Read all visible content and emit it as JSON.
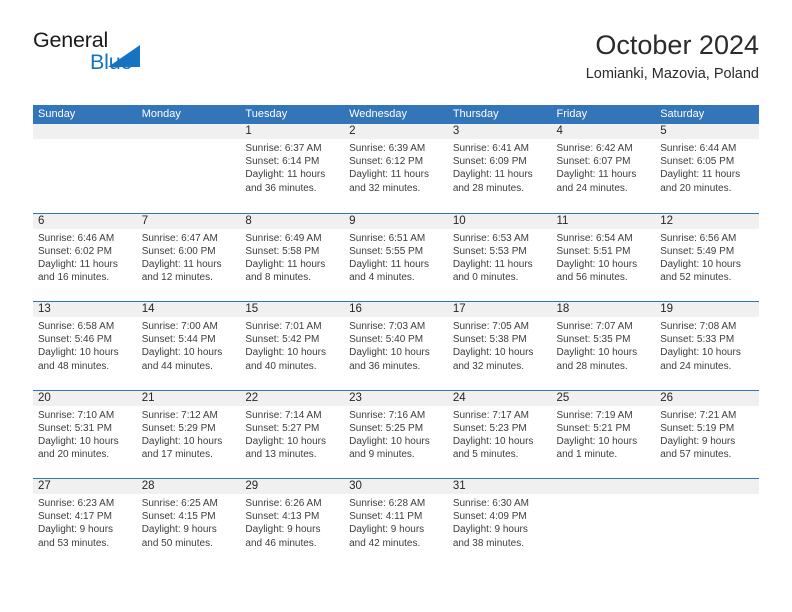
{
  "brand": {
    "name_top": "General",
    "name_bottom": "Blue",
    "triangle_color": "#1673c1",
    "top_color": "#1a1a1a",
    "bottom_color": "#1673c1"
  },
  "header": {
    "title": "October 2024",
    "location": "Lomianki, Mazovia, Poland"
  },
  "theme": {
    "header_blue": "#3275b8",
    "daynum_band": "#f0f0f0",
    "text": "#3d3d3d"
  },
  "weekday_headers": [
    "Sunday",
    "Monday",
    "Tuesday",
    "Wednesday",
    "Thursday",
    "Friday",
    "Saturday"
  ],
  "weeks": [
    [
      {
        "day": "",
        "sunrise": "",
        "sunset": "",
        "daylight_1": "",
        "daylight_2": "",
        "empty": true
      },
      {
        "day": "",
        "sunrise": "",
        "sunset": "",
        "daylight_1": "",
        "daylight_2": "",
        "empty": true
      },
      {
        "day": "1",
        "sunrise": "Sunrise: 6:37 AM",
        "sunset": "Sunset: 6:14 PM",
        "daylight_1": "Daylight: 11 hours",
        "daylight_2": "and 36 minutes."
      },
      {
        "day": "2",
        "sunrise": "Sunrise: 6:39 AM",
        "sunset": "Sunset: 6:12 PM",
        "daylight_1": "Daylight: 11 hours",
        "daylight_2": "and 32 minutes."
      },
      {
        "day": "3",
        "sunrise": "Sunrise: 6:41 AM",
        "sunset": "Sunset: 6:09 PM",
        "daylight_1": "Daylight: 11 hours",
        "daylight_2": "and 28 minutes."
      },
      {
        "day": "4",
        "sunrise": "Sunrise: 6:42 AM",
        "sunset": "Sunset: 6:07 PM",
        "daylight_1": "Daylight: 11 hours",
        "daylight_2": "and 24 minutes."
      },
      {
        "day": "5",
        "sunrise": "Sunrise: 6:44 AM",
        "sunset": "Sunset: 6:05 PM",
        "daylight_1": "Daylight: 11 hours",
        "daylight_2": "and 20 minutes."
      }
    ],
    [
      {
        "day": "6",
        "sunrise": "Sunrise: 6:46 AM",
        "sunset": "Sunset: 6:02 PM",
        "daylight_1": "Daylight: 11 hours",
        "daylight_2": "and 16 minutes."
      },
      {
        "day": "7",
        "sunrise": "Sunrise: 6:47 AM",
        "sunset": "Sunset: 6:00 PM",
        "daylight_1": "Daylight: 11 hours",
        "daylight_2": "and 12 minutes."
      },
      {
        "day": "8",
        "sunrise": "Sunrise: 6:49 AM",
        "sunset": "Sunset: 5:58 PM",
        "daylight_1": "Daylight: 11 hours",
        "daylight_2": "and 8 minutes."
      },
      {
        "day": "9",
        "sunrise": "Sunrise: 6:51 AM",
        "sunset": "Sunset: 5:55 PM",
        "daylight_1": "Daylight: 11 hours",
        "daylight_2": "and 4 minutes."
      },
      {
        "day": "10",
        "sunrise": "Sunrise: 6:53 AM",
        "sunset": "Sunset: 5:53 PM",
        "daylight_1": "Daylight: 11 hours",
        "daylight_2": "and 0 minutes."
      },
      {
        "day": "11",
        "sunrise": "Sunrise: 6:54 AM",
        "sunset": "Sunset: 5:51 PM",
        "daylight_1": "Daylight: 10 hours",
        "daylight_2": "and 56 minutes."
      },
      {
        "day": "12",
        "sunrise": "Sunrise: 6:56 AM",
        "sunset": "Sunset: 5:49 PM",
        "daylight_1": "Daylight: 10 hours",
        "daylight_2": "and 52 minutes."
      }
    ],
    [
      {
        "day": "13",
        "sunrise": "Sunrise: 6:58 AM",
        "sunset": "Sunset: 5:46 PM",
        "daylight_1": "Daylight: 10 hours",
        "daylight_2": "and 48 minutes."
      },
      {
        "day": "14",
        "sunrise": "Sunrise: 7:00 AM",
        "sunset": "Sunset: 5:44 PM",
        "daylight_1": "Daylight: 10 hours",
        "daylight_2": "and 44 minutes."
      },
      {
        "day": "15",
        "sunrise": "Sunrise: 7:01 AM",
        "sunset": "Sunset: 5:42 PM",
        "daylight_1": "Daylight: 10 hours",
        "daylight_2": "and 40 minutes."
      },
      {
        "day": "16",
        "sunrise": "Sunrise: 7:03 AM",
        "sunset": "Sunset: 5:40 PM",
        "daylight_1": "Daylight: 10 hours",
        "daylight_2": "and 36 minutes."
      },
      {
        "day": "17",
        "sunrise": "Sunrise: 7:05 AM",
        "sunset": "Sunset: 5:38 PM",
        "daylight_1": "Daylight: 10 hours",
        "daylight_2": "and 32 minutes."
      },
      {
        "day": "18",
        "sunrise": "Sunrise: 7:07 AM",
        "sunset": "Sunset: 5:35 PM",
        "daylight_1": "Daylight: 10 hours",
        "daylight_2": "and 28 minutes."
      },
      {
        "day": "19",
        "sunrise": "Sunrise: 7:08 AM",
        "sunset": "Sunset: 5:33 PM",
        "daylight_1": "Daylight: 10 hours",
        "daylight_2": "and 24 minutes."
      }
    ],
    [
      {
        "day": "20",
        "sunrise": "Sunrise: 7:10 AM",
        "sunset": "Sunset: 5:31 PM",
        "daylight_1": "Daylight: 10 hours",
        "daylight_2": "and 20 minutes."
      },
      {
        "day": "21",
        "sunrise": "Sunrise: 7:12 AM",
        "sunset": "Sunset: 5:29 PM",
        "daylight_1": "Daylight: 10 hours",
        "daylight_2": "and 17 minutes."
      },
      {
        "day": "22",
        "sunrise": "Sunrise: 7:14 AM",
        "sunset": "Sunset: 5:27 PM",
        "daylight_1": "Daylight: 10 hours",
        "daylight_2": "and 13 minutes."
      },
      {
        "day": "23",
        "sunrise": "Sunrise: 7:16 AM",
        "sunset": "Sunset: 5:25 PM",
        "daylight_1": "Daylight: 10 hours",
        "daylight_2": "and 9 minutes."
      },
      {
        "day": "24",
        "sunrise": "Sunrise: 7:17 AM",
        "sunset": "Sunset: 5:23 PM",
        "daylight_1": "Daylight: 10 hours",
        "daylight_2": "and 5 minutes."
      },
      {
        "day": "25",
        "sunrise": "Sunrise: 7:19 AM",
        "sunset": "Sunset: 5:21 PM",
        "daylight_1": "Daylight: 10 hours",
        "daylight_2": "and 1 minute."
      },
      {
        "day": "26",
        "sunrise": "Sunrise: 7:21 AM",
        "sunset": "Sunset: 5:19 PM",
        "daylight_1": "Daylight: 9 hours",
        "daylight_2": "and 57 minutes."
      }
    ],
    [
      {
        "day": "27",
        "sunrise": "Sunrise: 6:23 AM",
        "sunset": "Sunset: 4:17 PM",
        "daylight_1": "Daylight: 9 hours",
        "daylight_2": "and 53 minutes."
      },
      {
        "day": "28",
        "sunrise": "Sunrise: 6:25 AM",
        "sunset": "Sunset: 4:15 PM",
        "daylight_1": "Daylight: 9 hours",
        "daylight_2": "and 50 minutes."
      },
      {
        "day": "29",
        "sunrise": "Sunrise: 6:26 AM",
        "sunset": "Sunset: 4:13 PM",
        "daylight_1": "Daylight: 9 hours",
        "daylight_2": "and 46 minutes."
      },
      {
        "day": "30",
        "sunrise": "Sunrise: 6:28 AM",
        "sunset": "Sunset: 4:11 PM",
        "daylight_1": "Daylight: 9 hours",
        "daylight_2": "and 42 minutes."
      },
      {
        "day": "31",
        "sunrise": "Sunrise: 6:30 AM",
        "sunset": "Sunset: 4:09 PM",
        "daylight_1": "Daylight: 9 hours",
        "daylight_2": "and 38 minutes."
      },
      {
        "day": "",
        "sunrise": "",
        "sunset": "",
        "daylight_1": "",
        "daylight_2": "",
        "empty": true
      },
      {
        "day": "",
        "sunrise": "",
        "sunset": "",
        "daylight_1": "",
        "daylight_2": "",
        "empty": true
      }
    ]
  ]
}
